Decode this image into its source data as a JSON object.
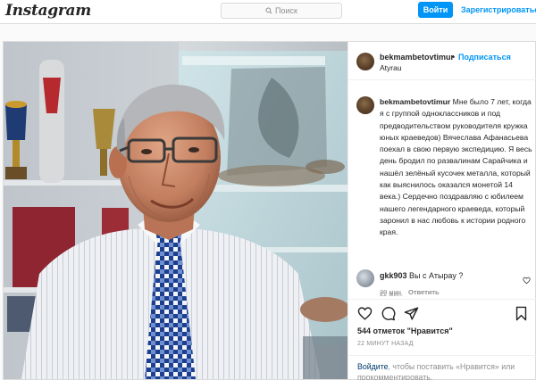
{
  "app": {
    "logo_text": "Instagram"
  },
  "topbar": {
    "search_placeholder": "Поиск",
    "login_label": "Войти",
    "register_label": "Зарегистрироваться"
  },
  "post": {
    "username": "bekmambetovtimur",
    "separator": "•",
    "follow_label": "Подписаться",
    "location": "Atyrau",
    "caption_username": "bekmambetovtimur",
    "caption_text": "Мне было 7 лет, когда я с группой одноклассников и под предводительством руководителя кружка юных краеведов) Вячеслава Афанасьева поехал в свою первую экспедицию. Я весь день бродил по развалинам Сарайчика и нашёл зелёный кусочек металла, который как выяснилось оказался монетой 14 века.) Сердечно поздравляю с юбилеем нашего легендарного краеведа, который заронил в нас любовь к истории родного края.",
    "caption_time": "22 мин.",
    "comment": {
      "username": "gkk903",
      "text": "Вы с Атырау ?",
      "time": "20 мин.",
      "reply_label": "Ответить"
    },
    "likes_count": "544",
    "likes_label": "отметок \"Нравится\"",
    "post_time": "22 МИНУТ НАЗАД",
    "login_prompt_link": "Войдите",
    "login_prompt_text": ", чтобы поставить «Нравится» или прокомментировать."
  },
  "icons": {
    "search": "search-icon",
    "like": "heart-icon",
    "comment": "comment-icon",
    "share": "share-icon",
    "save": "bookmark-icon",
    "comment_like": "small-heart-icon"
  },
  "colors": {
    "accent": "#0095f6",
    "text": "#262626",
    "muted": "#8e8e8e",
    "border": "#dbdbdb"
  }
}
